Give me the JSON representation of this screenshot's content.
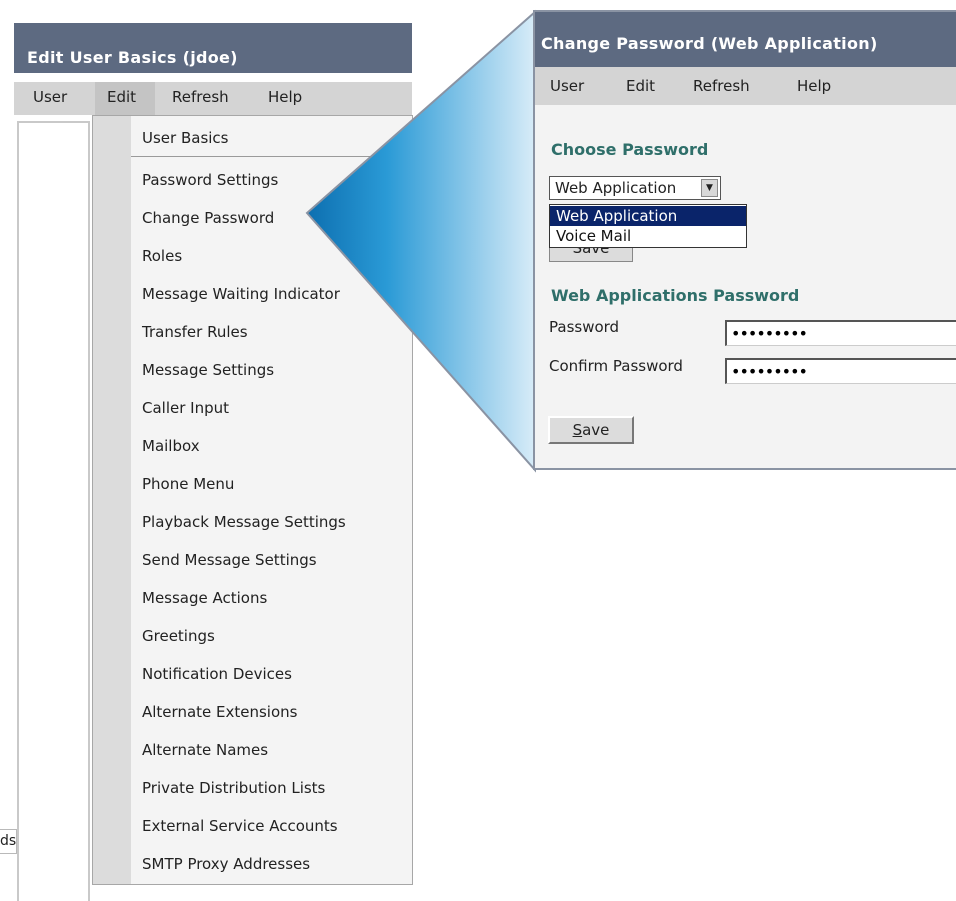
{
  "left_window": {
    "title": "Edit User Basics  (jdoe)",
    "menubar": [
      "User",
      "Edit",
      "Refresh",
      "Help"
    ],
    "edit_menu": [
      "User Basics",
      "Password Settings",
      "Change Password",
      "Roles",
      "Message Waiting Indicator",
      "Transfer Rules",
      "Message Settings",
      "Caller Input",
      "Mailbox",
      "Phone Menu",
      "Playback Message Settings",
      "Send Message Settings",
      "Message Actions",
      "Greetings",
      "Notification Devices",
      "Alternate Extensions",
      "Alternate Names",
      "Private Distribution Lists",
      "External Service Accounts",
      "SMTP Proxy Addresses"
    ],
    "bottom_fragment": "ds"
  },
  "right_window": {
    "title": "Change Password  (Web Application)",
    "menubar": [
      "User",
      "Edit",
      "Refresh",
      "Help"
    ],
    "choose_heading": "Choose Password",
    "select_value": "Web Application",
    "options": [
      "Web Application",
      "Voice Mail"
    ],
    "hidden_button": "Save",
    "web_heading": "Web Applications Password",
    "password_label": "Password",
    "password_value": "•••••••••",
    "confirm_label": "Confirm Password",
    "confirm_value": "•••••••••",
    "save_label": "ave",
    "save_accel": "S"
  },
  "colors": {
    "title_bar": "#5d6a81",
    "menubar": "#d4d4d4",
    "heading": "#2f6f6a",
    "selected_option": "#0a246a",
    "callout_blue": "#1a86c8"
  }
}
